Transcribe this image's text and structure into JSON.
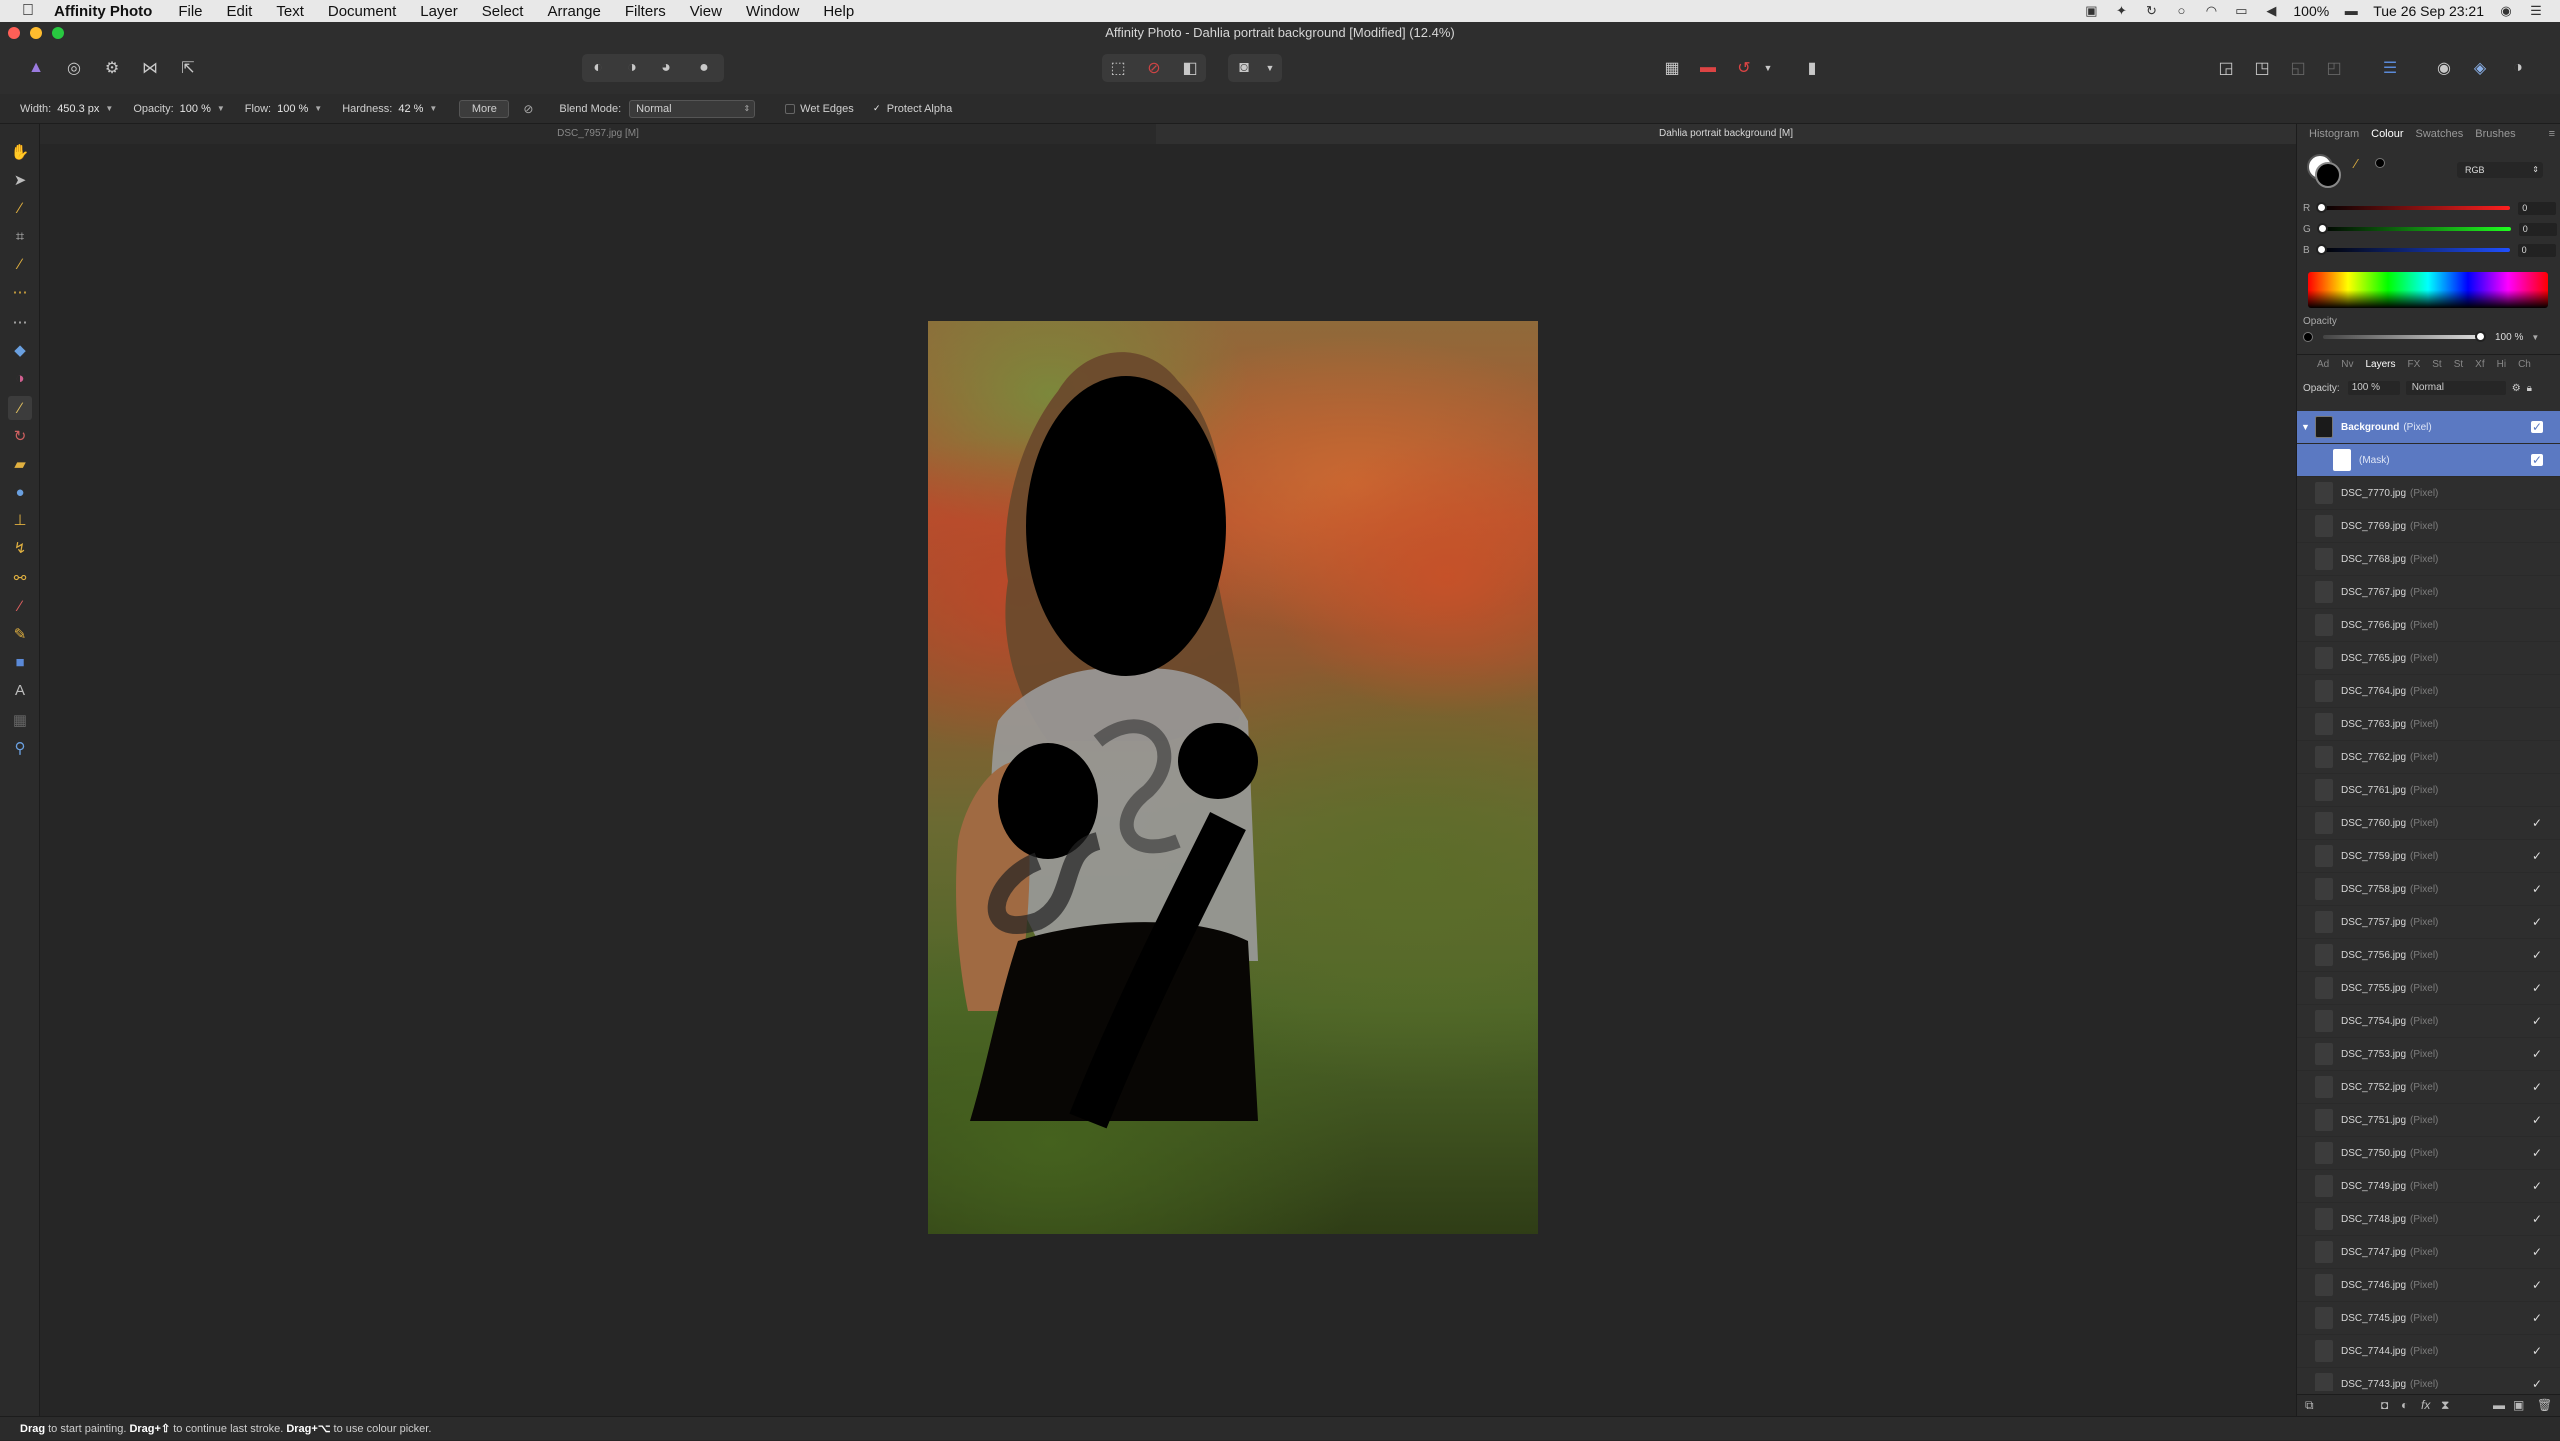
{
  "menubar": {
    "app_name": "Affinity Photo",
    "items": [
      "File",
      "Edit",
      "Text",
      "Document",
      "Layer",
      "Select",
      "Arrange",
      "Filters",
      "View",
      "Window",
      "Help"
    ],
    "battery": "100%",
    "clock": "Tue 26 Sep  23:21"
  },
  "window": {
    "title": "Affinity Photo - Dahlia portrait background [Modified] (12.4%)"
  },
  "context_toolbar": {
    "width_label": "Width:",
    "width_value": "450.3 px",
    "opacity_label": "Opacity:",
    "opacity_value": "100 %",
    "flow_label": "Flow:",
    "flow_value": "100 %",
    "hardness_label": "Hardness:",
    "hardness_value": "42 %",
    "more_label": "More",
    "blend_label": "Blend Mode:",
    "blend_value": "Normal",
    "wet_edges_label": "Wet Edges",
    "protect_alpha_label": "Protect Alpha"
  },
  "tabs": {
    "doc1": "DSC_7957.jpg [M]",
    "doc2": "Dahlia portrait background [M]"
  },
  "status": {
    "b1": "Drag",
    "t1": " to start painting. ",
    "b2": "Drag+⇧",
    "t2": " to continue last stroke. ",
    "b3": "Drag+⌥",
    "t3": " to use colour picker."
  },
  "colour_panel": {
    "tabs": [
      "Histogram",
      "Colour",
      "Swatches",
      "Brushes"
    ],
    "model": "RGB",
    "r_label": "R",
    "r_value": "0",
    "g_label": "G",
    "g_value": "0",
    "b_label": "B",
    "b_value": "0",
    "opacity_label": "Opacity",
    "opacity_value": "100 %"
  },
  "layers_panel": {
    "tabs": [
      "Ad",
      "Nv",
      "Layers",
      "FX",
      "St",
      "St",
      "Xf",
      "Hi",
      "Ch"
    ],
    "opacity_label": "Opacity:",
    "opacity_value": "100 %",
    "blend_value": "Normal",
    "selected": {
      "name": "Background",
      "type": "(Pixel)"
    },
    "mask": {
      "name": "(Mask)"
    },
    "layers": [
      {
        "name": "DSC_7770.jpg",
        "type": "(Pixel)",
        "visible": false
      },
      {
        "name": "DSC_7769.jpg",
        "type": "(Pixel)",
        "visible": false
      },
      {
        "name": "DSC_7768.jpg",
        "type": "(Pixel)",
        "visible": false
      },
      {
        "name": "DSC_7767.jpg",
        "type": "(Pixel)",
        "visible": false
      },
      {
        "name": "DSC_7766.jpg",
        "type": "(Pixel)",
        "visible": false
      },
      {
        "name": "DSC_7765.jpg",
        "type": "(Pixel)",
        "visible": false
      },
      {
        "name": "DSC_7764.jpg",
        "type": "(Pixel)",
        "visible": false
      },
      {
        "name": "DSC_7763.jpg",
        "type": "(Pixel)",
        "visible": false
      },
      {
        "name": "DSC_7762.jpg",
        "type": "(Pixel)",
        "visible": false
      },
      {
        "name": "DSC_7761.jpg",
        "type": "(Pixel)",
        "visible": false
      },
      {
        "name": "DSC_7760.jpg",
        "type": "(Pixel)",
        "visible": true
      },
      {
        "name": "DSC_7759.jpg",
        "type": "(Pixel)",
        "visible": true
      },
      {
        "name": "DSC_7758.jpg",
        "type": "(Pixel)",
        "visible": true
      },
      {
        "name": "DSC_7757.jpg",
        "type": "(Pixel)",
        "visible": true
      },
      {
        "name": "DSC_7756.jpg",
        "type": "(Pixel)",
        "visible": true
      },
      {
        "name": "DSC_7755.jpg",
        "type": "(Pixel)",
        "visible": true
      },
      {
        "name": "DSC_7754.jpg",
        "type": "(Pixel)",
        "visible": true
      },
      {
        "name": "DSC_7753.jpg",
        "type": "(Pixel)",
        "visible": true
      },
      {
        "name": "DSC_7752.jpg",
        "type": "(Pixel)",
        "visible": true
      },
      {
        "name": "DSC_7751.jpg",
        "type": "(Pixel)",
        "visible": true
      },
      {
        "name": "DSC_7750.jpg",
        "type": "(Pixel)",
        "visible": true
      },
      {
        "name": "DSC_7749.jpg",
        "type": "(Pixel)",
        "visible": true
      },
      {
        "name": "DSC_7748.jpg",
        "type": "(Pixel)",
        "visible": true
      },
      {
        "name": "DSC_7747.jpg",
        "type": "(Pixel)",
        "visible": true
      },
      {
        "name": "DSC_7746.jpg",
        "type": "(Pixel)",
        "visible": true
      },
      {
        "name": "DSC_7745.jpg",
        "type": "(Pixel)",
        "visible": true
      },
      {
        "name": "DSC_7744.jpg",
        "type": "(Pixel)",
        "visible": true
      },
      {
        "name": "DSC_7743.jpg",
        "type": "(Pixel)",
        "visible": true
      }
    ]
  },
  "colors": {
    "selection_accent": "#5b79c2",
    "panel_bg": "#2e2e2e",
    "canvas_bg": "#262626"
  }
}
